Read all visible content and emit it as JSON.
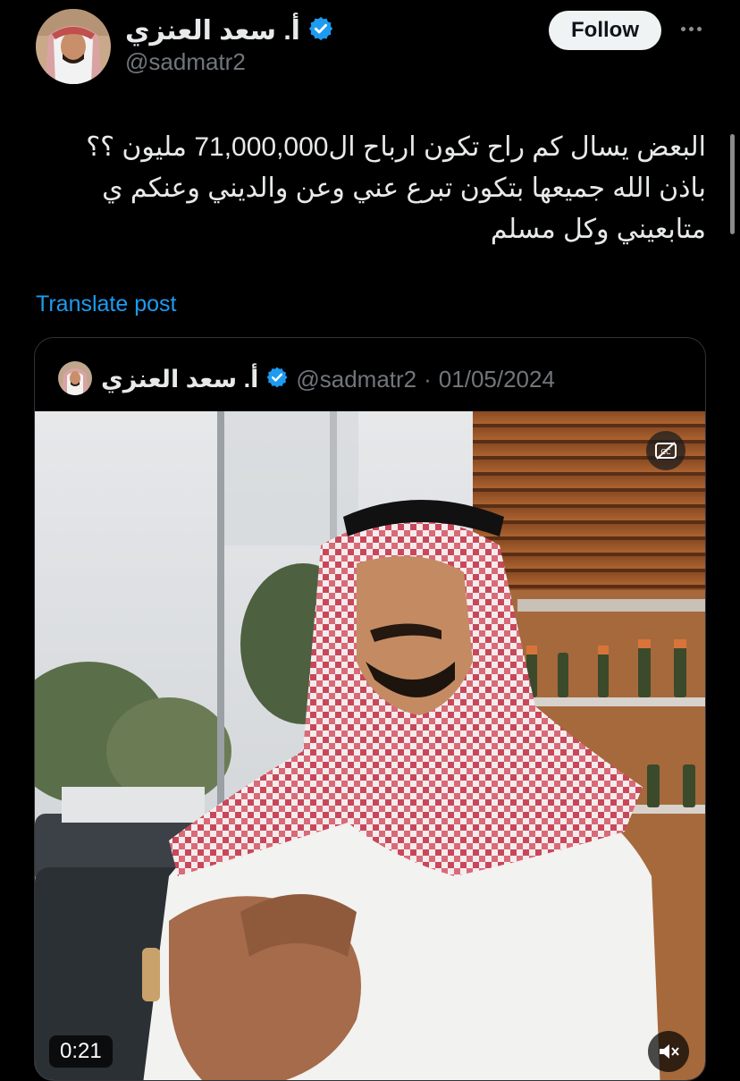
{
  "author": {
    "name": "أ. سعد العنزي",
    "handle": "@sadmatr2",
    "verified_icon": "verified-badge-icon",
    "verified_color": "#1d9bf0"
  },
  "header": {
    "follow_label": "Follow",
    "more_icon": "more-options-icon"
  },
  "post": {
    "lines": [
      "البعض يسال كم راح تكون ارباح ال71,000,000 مليون ؟؟",
      "باذن الله جميعها بتكون تبرع عني وعن والديني وعنكم ي",
      "متابعيني وكل مسلم"
    ],
    "translate_label": "Translate post",
    "link_color": "#1d9bf0"
  },
  "quoted": {
    "name": "أ. سعد العنزي",
    "handle": "@sadmatr2",
    "separator": "·",
    "date": "01/05/2024",
    "video": {
      "duration": "0:21",
      "cc_icon": "closed-captions-off-icon",
      "mute_icon": "muted-speaker-icon"
    }
  },
  "colors": {
    "background": "#000000",
    "text_primary": "#e7e9ea",
    "text_secondary": "#71767b",
    "follow_bg": "#eff3f4"
  }
}
